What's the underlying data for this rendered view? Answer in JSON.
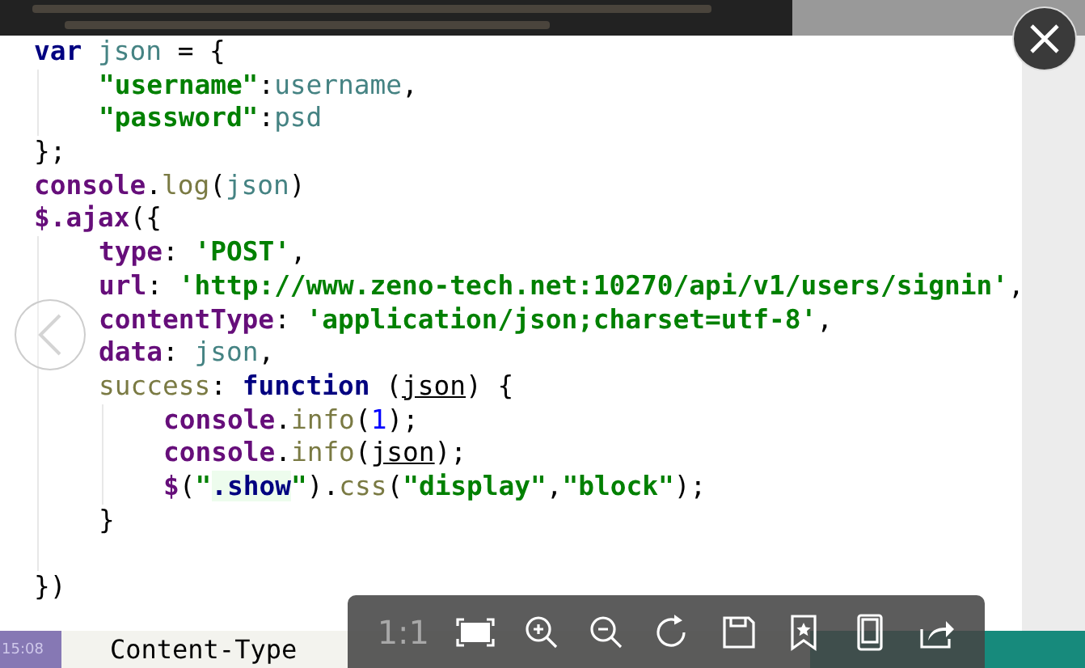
{
  "code": {
    "lines": [
      {
        "kind": "code",
        "tokens": [
          {
            "kind": "kw",
            "text": "var"
          },
          {
            "kind": "var",
            "text": " json"
          },
          {
            "kind": "plain",
            "text": " = {"
          }
        ],
        "children": [
          {
            "kind": "code",
            "tokens": [
              {
                "kind": "str",
                "text": "\"username\""
              },
              {
                "kind": "plain",
                "text": ":"
              },
              {
                "kind": "var",
                "text": "username"
              },
              {
                "kind": "plain",
                "text": ","
              }
            ]
          },
          {
            "kind": "code",
            "tokens": [
              {
                "kind": "str",
                "text": "\"password\""
              },
              {
                "kind": "plain",
                "text": ":"
              },
              {
                "kind": "var",
                "text": "psd"
              }
            ]
          }
        ]
      },
      {
        "kind": "code",
        "tokens": [
          {
            "kind": "plain",
            "text": "};"
          }
        ]
      },
      {
        "kind": "code",
        "tokens": [
          {
            "kind": "prop",
            "text": "console"
          },
          {
            "kind": "plain",
            "text": "."
          },
          {
            "kind": "fn",
            "text": "log"
          },
          {
            "kind": "plain",
            "text": "("
          },
          {
            "kind": "var",
            "text": "json"
          },
          {
            "kind": "plain",
            "text": ")"
          }
        ]
      },
      {
        "kind": "code",
        "tokens": [
          {
            "kind": "prop",
            "text": "$.ajax"
          },
          {
            "kind": "plain",
            "text": "({"
          }
        ],
        "children": [
          {
            "kind": "code",
            "tokens": [
              {
                "kind": "prop",
                "text": "type"
              },
              {
                "kind": "plain",
                "text": ": "
              },
              {
                "kind": "str",
                "text": "'POST'"
              },
              {
                "kind": "plain",
                "text": ","
              }
            ]
          },
          {
            "kind": "code",
            "tokens": [
              {
                "kind": "prop",
                "text": "url"
              },
              {
                "kind": "plain",
                "text": ": "
              },
              {
                "kind": "str",
                "text": "'http://www.zeno-tech.net:10270/api/v1/users/signin'"
              },
              {
                "kind": "plain",
                "text": ","
              }
            ]
          },
          {
            "kind": "code",
            "tokens": [
              {
                "kind": "prop",
                "text": "contentType"
              },
              {
                "kind": "plain",
                "text": ": "
              },
              {
                "kind": "str",
                "text": "'application/json;charset=utf-8'"
              },
              {
                "kind": "plain",
                "text": ","
              }
            ]
          },
          {
            "kind": "code",
            "tokens": [
              {
                "kind": "prop",
                "text": "data"
              },
              {
                "kind": "plain",
                "text": ": "
              },
              {
                "kind": "var",
                "text": "json"
              },
              {
                "kind": "plain",
                "text": ","
              }
            ]
          },
          {
            "kind": "code",
            "tokens": [
              {
                "kind": "fn",
                "text": "success"
              },
              {
                "kind": "plain",
                "text": ": "
              },
              {
                "kind": "kw",
                "text": "function"
              },
              {
                "kind": "plain",
                "text": " ("
              },
              {
                "kind": "param",
                "text": "json"
              },
              {
                "kind": "plain",
                "text": ") {"
              }
            ],
            "children": [
              {
                "kind": "code",
                "tokens": [
                  {
                    "kind": "prop",
                    "text": "console"
                  },
                  {
                    "kind": "plain",
                    "text": "."
                  },
                  {
                    "kind": "fn",
                    "text": "info"
                  },
                  {
                    "kind": "plain",
                    "text": "("
                  },
                  {
                    "kind": "num",
                    "text": "1"
                  },
                  {
                    "kind": "plain",
                    "text": ");"
                  }
                ]
              },
              {
                "kind": "code",
                "tokens": [
                  {
                    "kind": "prop",
                    "text": "console"
                  },
                  {
                    "kind": "plain",
                    "text": "."
                  },
                  {
                    "kind": "fn",
                    "text": "info"
                  },
                  {
                    "kind": "plain",
                    "text": "("
                  },
                  {
                    "kind": "param",
                    "text": "json"
                  },
                  {
                    "kind": "plain",
                    "text": ");"
                  }
                ]
              },
              {
                "kind": "code",
                "tokens": [
                  {
                    "kind": "prop",
                    "text": "$"
                  },
                  {
                    "kind": "plain",
                    "text": "("
                  },
                  {
                    "kind": "str",
                    "text": "\""
                  },
                  {
                    "kind": "sel",
                    "text": ".show"
                  },
                  {
                    "kind": "str",
                    "text": "\""
                  },
                  {
                    "kind": "plain",
                    "text": ")."
                  },
                  {
                    "kind": "fn",
                    "text": "css"
                  },
                  {
                    "kind": "plain",
                    "text": "("
                  },
                  {
                    "kind": "str",
                    "text": "\"display\""
                  },
                  {
                    "kind": "plain",
                    "text": ","
                  },
                  {
                    "kind": "str",
                    "text": "\"block\""
                  },
                  {
                    "kind": "plain",
                    "text": ");"
                  }
                ]
              }
            ]
          },
          {
            "kind": "code",
            "tokens": [
              {
                "kind": "plain",
                "text": "}"
              }
            ]
          },
          {
            "kind": "blank"
          }
        ]
      },
      {
        "kind": "code",
        "tokens": [
          {
            "kind": "plain",
            "text": "})"
          }
        ]
      }
    ]
  },
  "background": {
    "time": "15:08",
    "code_line": "Content-Type"
  },
  "toolbar": {
    "ratio_label": "1:1",
    "ratio_disabled": true
  }
}
